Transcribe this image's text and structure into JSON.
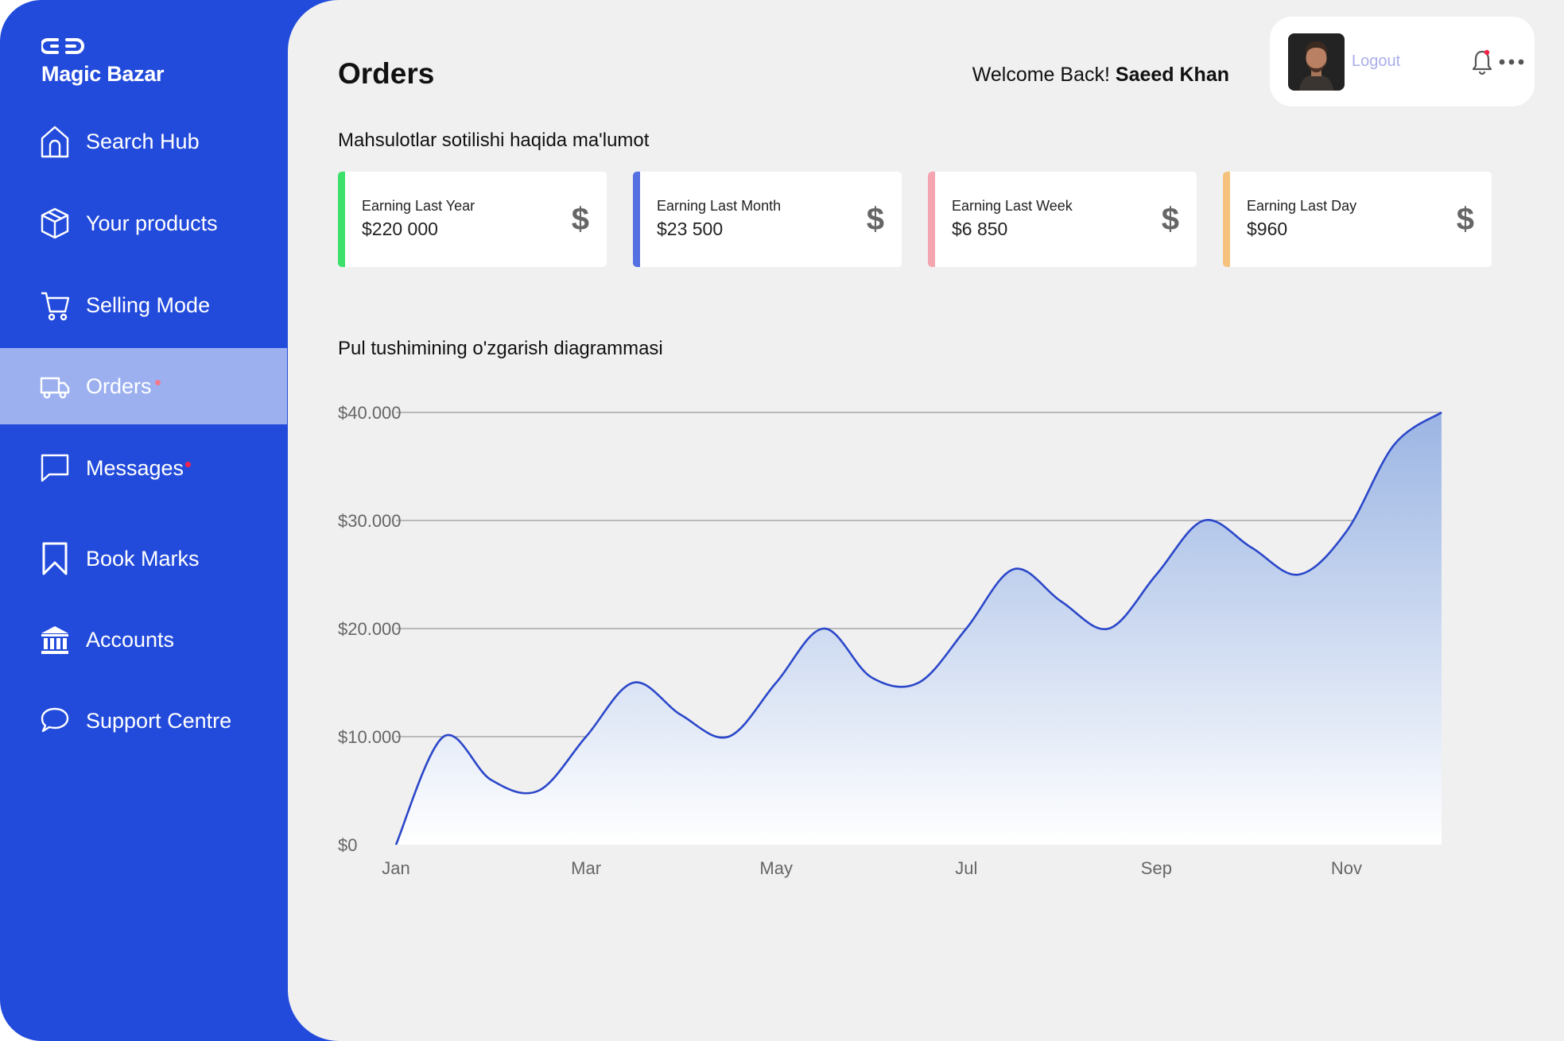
{
  "brand": {
    "name": "Magic Bazar"
  },
  "nav": {
    "items": [
      {
        "label": "Search Hub",
        "icon": "home-icon"
      },
      {
        "label": "Your products",
        "icon": "box-icon"
      },
      {
        "label": "Selling Mode",
        "icon": "cart-icon"
      },
      {
        "label": "Orders",
        "icon": "truck-icon",
        "active": true,
        "notification_dot": "#F27A8E"
      },
      {
        "label": "Messages",
        "icon": "message-icon",
        "notification_dot": "#F2234A"
      },
      {
        "label": "Book Marks",
        "icon": "bookmark-icon"
      },
      {
        "label": "Accounts",
        "icon": "bank-icon"
      },
      {
        "label": "Support Centre",
        "icon": "chat-bubble-icon"
      }
    ]
  },
  "header": {
    "title": "Orders",
    "welcome_text": "Welcome Back!",
    "user_name": "Saeed Khan",
    "logout_label": "Logout"
  },
  "summary": {
    "heading": "Mahsulotlar sotilishi haqida ma'lumot",
    "cards": [
      {
        "label": "Earning Last Year",
        "value": "$220 000",
        "accent": "#3CE06A",
        "icon": "$"
      },
      {
        "label": "Earning Last Month",
        "value": "$23 500",
        "accent": "#5570E0",
        "icon": "$"
      },
      {
        "label": "Earning Last Week",
        "value": "$6 850",
        "accent": "#F4A5B0",
        "icon": "$"
      },
      {
        "label": "Earning Last Day",
        "value": "$960",
        "accent": "#F5C27E",
        "icon": "$"
      }
    ]
  },
  "chart_section": {
    "heading": "Pul tushimining o'zgarish diagrammasi"
  },
  "chart_data": {
    "type": "area",
    "title": "Pul tushimining o'zgarish diagrammasi",
    "x": [
      0,
      0.5,
      1,
      1.5,
      2,
      2.5,
      3,
      3.5,
      4,
      4.5,
      5,
      5.5,
      6,
      6.5,
      7,
      7.5,
      8,
      8.5,
      9,
      9.5,
      10,
      10.5,
      11
    ],
    "values": [
      0,
      10000,
      6000,
      5000,
      10000,
      15000,
      12000,
      10000,
      15000,
      20000,
      15500,
      15000,
      20000,
      25500,
      22500,
      20000,
      25000,
      30000,
      27500,
      25000,
      29000,
      37000,
      40000
    ],
    "x_tick_values": [
      0,
      2,
      4,
      6,
      8,
      10
    ],
    "x_tick_labels": [
      "Jan",
      "Mar",
      "May",
      "Jul",
      "Sep",
      "Nov"
    ],
    "y_tick_values": [
      0,
      10000,
      20000,
      30000,
      40000
    ],
    "y_tick_labels": [
      "$0",
      "$10.000",
      "$20.000",
      "$30.000",
      "$40.000"
    ],
    "ylim": [
      0,
      40000
    ],
    "xlim": [
      0,
      11
    ],
    "grid": "horizontal",
    "line_color": "#2B47C9",
    "fill_top_color": "#9BB5E3",
    "fill_bottom_color": "#FFFFFF"
  }
}
